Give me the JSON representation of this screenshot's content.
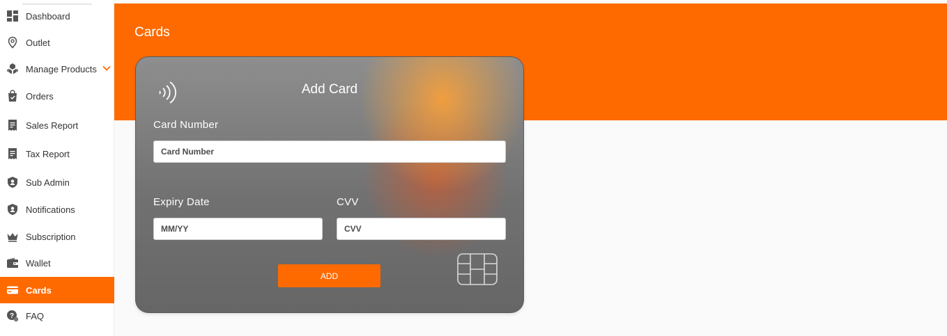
{
  "sidebar": {
    "items": [
      {
        "label": "Dashboard",
        "icon": "dashboard-icon"
      },
      {
        "label": "Outlet",
        "icon": "map-pin-icon"
      },
      {
        "label": "Manage Products",
        "icon": "products-icon",
        "expandable": true
      },
      {
        "label": "Orders",
        "icon": "shopping-bag-icon"
      },
      {
        "label": "Sales Report",
        "icon": "report-icon"
      },
      {
        "label": "Tax Report",
        "icon": "report-icon"
      },
      {
        "label": "Sub Admin",
        "icon": "user-shield-icon"
      },
      {
        "label": "Notifications",
        "icon": "user-shield-icon"
      },
      {
        "label": "Subscription",
        "icon": "crown-icon"
      },
      {
        "label": "Wallet",
        "icon": "wallet-icon"
      },
      {
        "label": "Cards",
        "icon": "card-icon",
        "active": true
      },
      {
        "label": "FAQ",
        "icon": "faq-icon"
      }
    ]
  },
  "header": {
    "title": "Cards"
  },
  "card": {
    "title": "Add Card",
    "card_number_label": "Card Number",
    "card_number_placeholder": "Card Number",
    "expiry_label": "Expiry Date",
    "expiry_placeholder": "MM/YY",
    "cvv_label": "CVV",
    "cvv_placeholder": "CVV",
    "add_label": "ADD"
  },
  "colors": {
    "accent": "#ff6a00",
    "sidebar_bg": "#ffffff",
    "page_bg": "#fafafa"
  }
}
